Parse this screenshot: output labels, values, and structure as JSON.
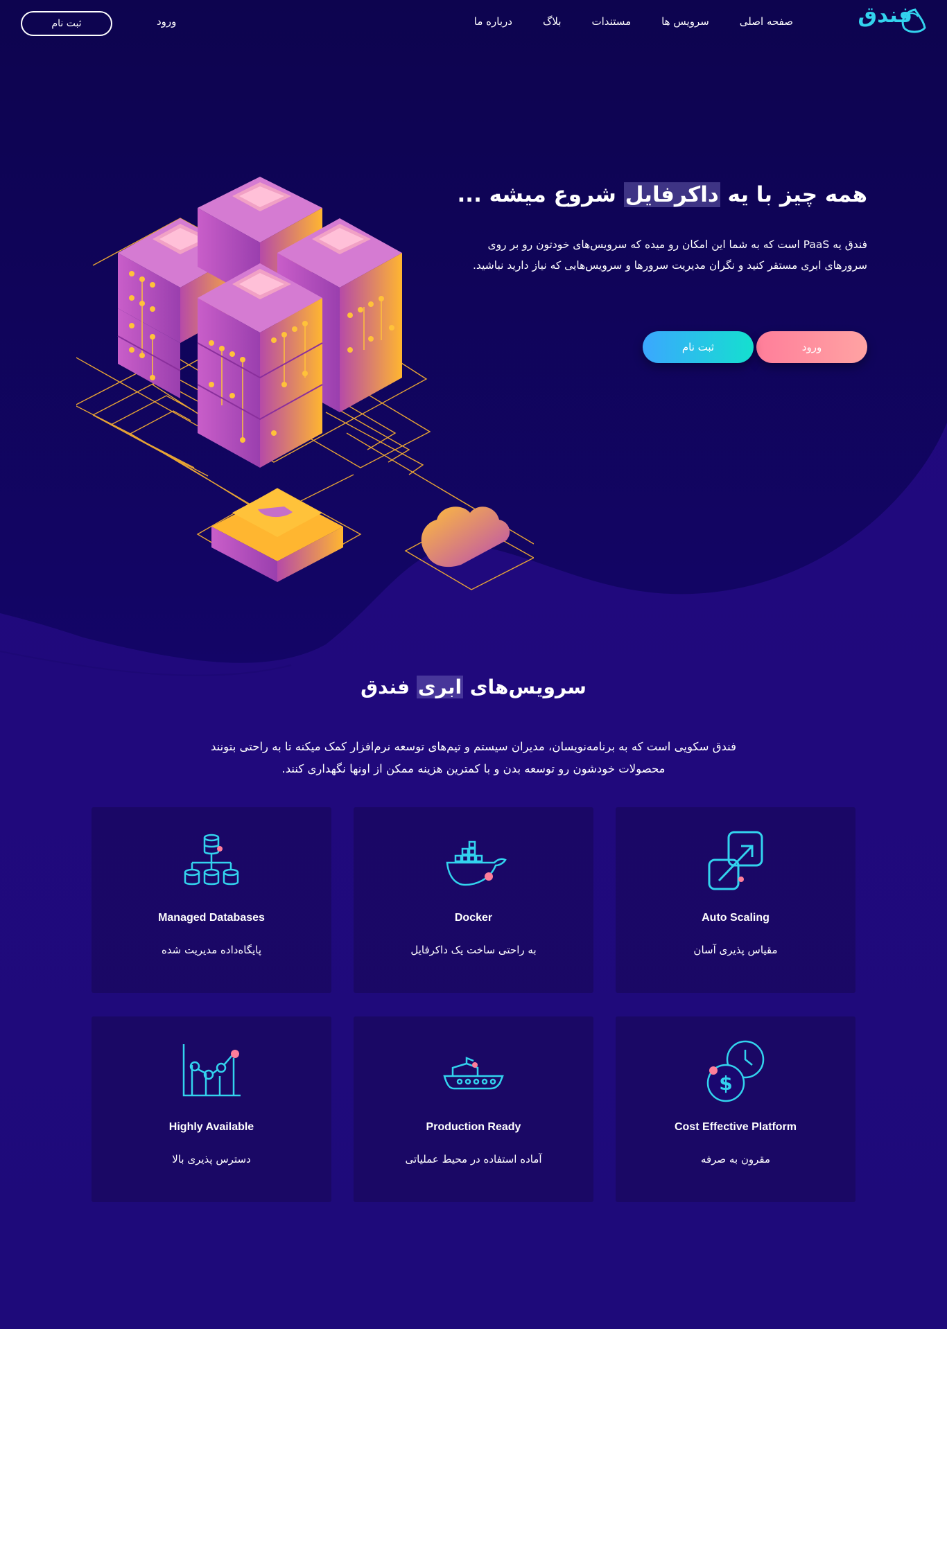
{
  "nav": {
    "logo_text": "فندق",
    "items": [
      "صفحه اصلی",
      "سرویس ها",
      "مستندات",
      "بلاگ",
      "درباره ما"
    ],
    "login": "ورود",
    "signup": "ثبت نام"
  },
  "hero": {
    "title_pre": "همه چیز با یه ",
    "title_highlight": "داکرفایل",
    "title_post": " شروع میشه ...",
    "description": "فندق یه PaaS است که به شما این امکان رو میده که سرویس‌های خودتون رو بر روی سرورهای ابری مستقر کنید و نگران مدیریت سرورها و سرویس‌هایی که نیاز دارید نباشید.",
    "login_button": "ورود",
    "signup_button": "ثبت نام"
  },
  "services": {
    "title_pre": "سرویس‌های ",
    "title_highlight": "ابری",
    "title_post": " فندق",
    "description": "فندق سکویی است که به برنامه‌نویسان، مدیران سیستم و تیم‌های توسعه نرم‌افزار کمک میکنه تا به راحتی بتونند محصولات خودشون رو توسعه بدن و با کمترین هزینه ممکن از اونها نگهداری کنند.",
    "cards": [
      {
        "title": "Auto Scaling",
        "subtitle": "مقیاس پذیری آسان",
        "icon": "scaling-icon"
      },
      {
        "title": "Docker",
        "subtitle": "به راحتی ساخت یک داکرفایل",
        "icon": "docker-whale-icon"
      },
      {
        "title": "Managed Databases",
        "subtitle": "پایگاه‌داده مدیریت شده",
        "icon": "database-icon"
      },
      {
        "title": "Cost Effective Platform",
        "subtitle": "مقرون به صرفه",
        "icon": "dollar-clock-icon"
      },
      {
        "title": "Production Ready",
        "subtitle": "آماده استفاده در محیط عملیاتی",
        "icon": "ship-icon"
      },
      {
        "title": "Highly Available",
        "subtitle": "دسترس پذیری بالا",
        "icon": "chart-line-icon"
      }
    ]
  },
  "colors": {
    "hero_bg": "#0f0456",
    "section_bg": "#1d0a7c",
    "accent_cyan": "#33d3ee",
    "pink": "#ff7e9a"
  }
}
